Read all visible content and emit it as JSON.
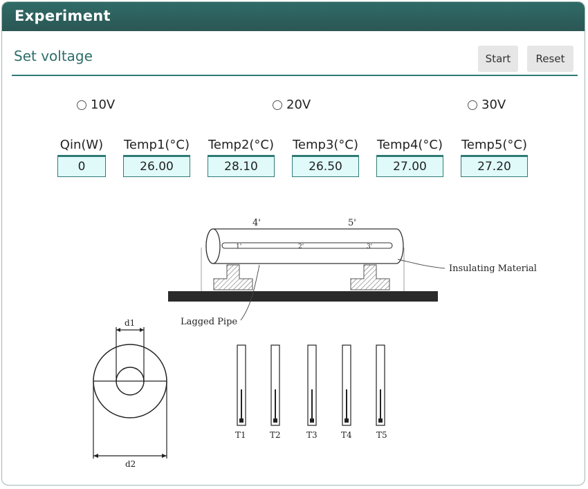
{
  "header": {
    "title": "Experiment"
  },
  "voltage": {
    "title": "Set voltage",
    "start_label": "Start",
    "reset_label": "Reset",
    "options": [
      "10V",
      "20V",
      "30V"
    ]
  },
  "readings": [
    {
      "label": "Qin(W)",
      "value": "0"
    },
    {
      "label": "Temp1(°C)",
      "value": "26.00"
    },
    {
      "label": "Temp2(°C)",
      "value": "28.10"
    },
    {
      "label": "Temp3(°C)",
      "value": "26.50"
    },
    {
      "label": "Temp4(°C)",
      "value": "27.00"
    },
    {
      "label": "Temp5(°C)",
      "value": "27.20"
    }
  ],
  "diagram": {
    "pipe_labels": [
      "4'",
      "5'",
      "1'",
      "2'",
      "3'"
    ],
    "insulating_label": "Insulating Material",
    "lagged_label": "Lagged Pipe",
    "d1_label": "d1",
    "d2_label": "d2",
    "thermometers": [
      "T1",
      "T2",
      "T3",
      "T4",
      "T5"
    ]
  }
}
